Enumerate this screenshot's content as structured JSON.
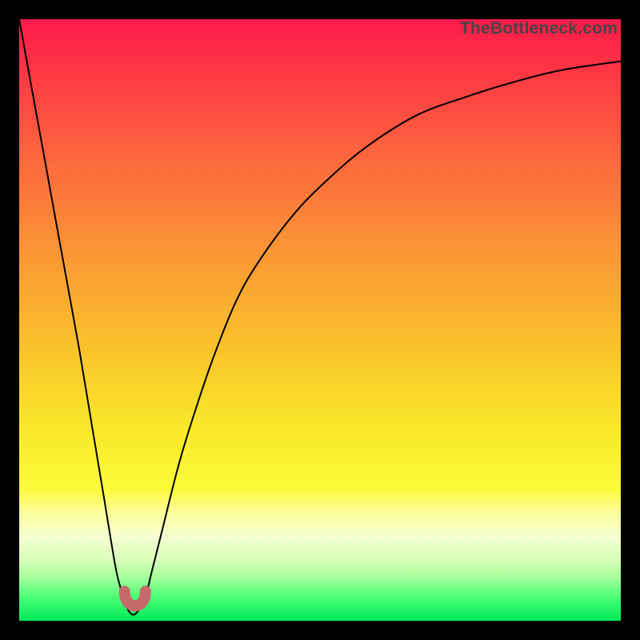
{
  "watermark": "TheBottleneck.com",
  "chart_data": {
    "type": "line",
    "title": "",
    "xlabel": "",
    "ylabel": "",
    "xlim": [
      0,
      100
    ],
    "ylim": [
      0,
      100
    ],
    "notes": "Heatmap-style background: red (top, worst) → green (bottom, best). Curve shows bottleneck percentage vs. component index; minimum around x≈19.",
    "series": [
      {
        "name": "bottleneck-curve",
        "x": [
          0,
          2,
          4,
          6,
          8,
          10,
          12,
          14,
          16,
          17,
          18,
          19,
          20,
          21,
          22,
          24,
          26,
          28,
          32,
          36,
          40,
          46,
          52,
          58,
          66,
          74,
          82,
          90,
          100
        ],
        "values": [
          100,
          89,
          78,
          67,
          56,
          45,
          33,
          21,
          9,
          5,
          2,
          1,
          2,
          4,
          8,
          16,
          24,
          31,
          43,
          53,
          60,
          68,
          74,
          79,
          84,
          87,
          89.5,
          91.5,
          93
        ]
      }
    ],
    "marker": {
      "name": "optimum-marker",
      "x_range": [
        17.5,
        21
      ],
      "y": 2.5,
      "color": "#c66a6a"
    },
    "background_gradient_stops": [
      {
        "pos": 0,
        "color": "#fd1a4a"
      },
      {
        "pos": 36,
        "color": "#fb8e37"
      },
      {
        "pos": 68,
        "color": "#fae829"
      },
      {
        "pos": 86,
        "color": "#f7ffd2"
      },
      {
        "pos": 100,
        "color": "#00ea5a"
      }
    ]
  }
}
